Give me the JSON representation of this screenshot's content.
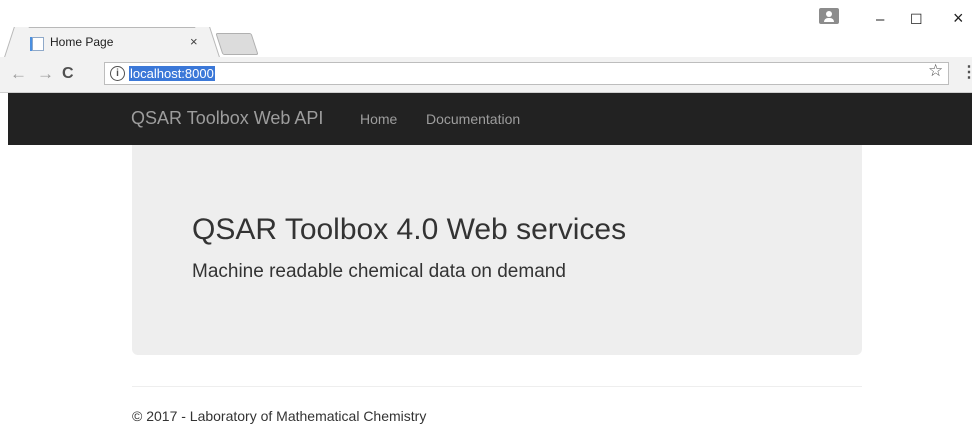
{
  "browser": {
    "tab_title": "Home Page",
    "tab_close": "×",
    "url": "localhost:8000",
    "window_minimize": "–",
    "window_maximize": "☐",
    "window_close": "×"
  },
  "site": {
    "brand": "QSAR Toolbox Web API",
    "nav": [
      {
        "label": "Home"
      },
      {
        "label": "Documentation"
      }
    ]
  },
  "jumbotron": {
    "title": "QSAR Toolbox 4.0 Web services",
    "lead": "Machine readable chemical data on demand"
  },
  "footer": {
    "text": "© 2017 - Laboratory of Mathematical Chemistry"
  },
  "colors": {
    "navbar_bg": "#222222",
    "nav_text": "#9d9d9d",
    "jumbotron_bg": "#eeeeee",
    "url_highlight": "#3b78d8"
  },
  "icons": {
    "back": "arrow-left-icon",
    "forward": "arrow-right-icon",
    "reload": "reload-icon",
    "info": "info-icon",
    "star": "star-icon",
    "menu": "kebab-menu-icon",
    "profile": "profile-icon",
    "favicon": "page-favicon-icon"
  }
}
